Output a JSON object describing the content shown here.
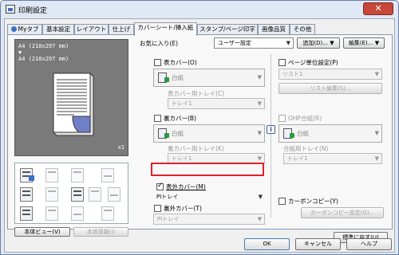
{
  "window": {
    "title": "印刷設定",
    "close_label": "✕"
  },
  "tabs": [
    {
      "label": "Myタブ"
    },
    {
      "label": "基本設定"
    },
    {
      "label": "レイアウト"
    },
    {
      "label": "仕上げ"
    },
    {
      "label": "カバーシート/挿入紙"
    },
    {
      "label": "スタンプ/ページ印字"
    },
    {
      "label": "画像品質"
    },
    {
      "label": "その他"
    }
  ],
  "preview": {
    "line1": "A4 (210x297 mm)",
    "arrow": "▼",
    "line2": "A4 (210x297 mm)",
    "copies": "x1"
  },
  "left_buttons": {
    "view": "本体ビュー(V)",
    "info": "本体情報(I)"
  },
  "favorites": {
    "label": "お気に入り(E)",
    "value": "ユーザー設定",
    "add": "追加(D)...",
    "edit": "編集(E)..."
  },
  "front_cover": {
    "label": "表カバー(O)",
    "paper": "白紙",
    "tray_label": "表カバー用トレイ(C)",
    "tray": "トレイ1"
  },
  "back_cover": {
    "label": "裏カバー(B)",
    "paper": "白紙",
    "tray_label": "裏カバー用トレイ(K)",
    "tray": "トレイ1"
  },
  "front_outer": {
    "label": "表外カバー(M)",
    "tray": "PIトレイ"
  },
  "back_outer": {
    "label": "裏外カバー(T)",
    "tray": "PIトレイ"
  },
  "page_unit": {
    "label": "ページ単位設定(P)",
    "list": "リスト1",
    "edit": "リスト編集(S)..."
  },
  "ohp": {
    "label": "OHP合紙(R)",
    "paper": "白紙",
    "tray_label": "合紙用トレイ(N)",
    "tray": "トレイ1"
  },
  "carbon": {
    "label": "カーボンコピー(Y)",
    "settings": "カーボンコピー設定(G)..."
  },
  "restore": "標準に戻す(U)",
  "footer": {
    "ok": "OK",
    "cancel": "キャンセル",
    "help": "ヘルプ"
  }
}
